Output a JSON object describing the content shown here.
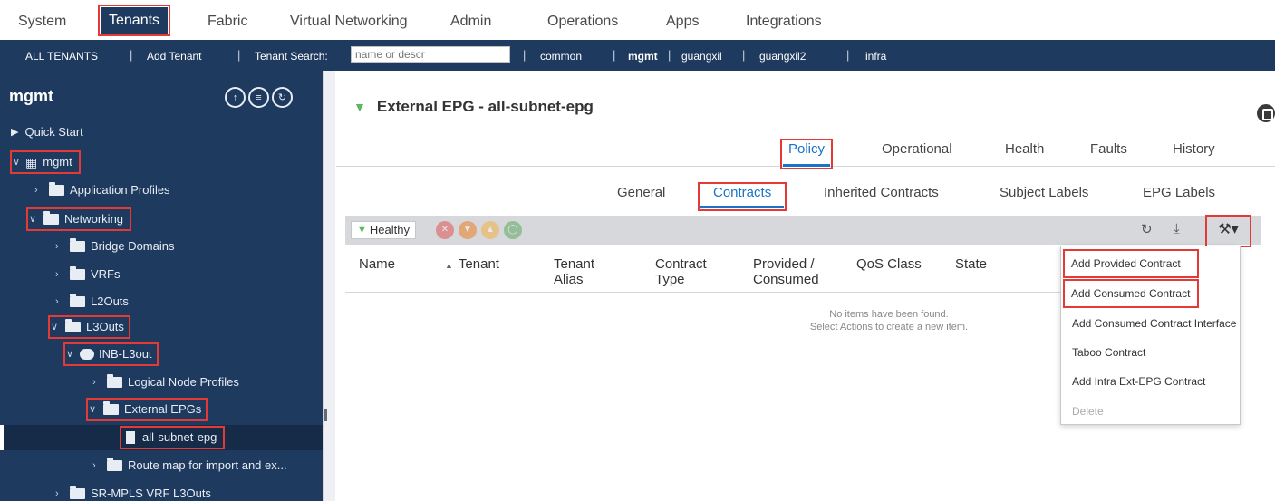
{
  "topmenu": {
    "items": [
      "System",
      "Tenants",
      "Fabric",
      "Virtual Networking",
      "Admin",
      "Operations",
      "Apps",
      "Integrations"
    ]
  },
  "tenantbar": {
    "all_tenants": "ALL TENANTS",
    "add_tenant": "Add Tenant",
    "search_label": "Tenant Search:",
    "search_placeholder": "name or descr",
    "tenants": [
      "common",
      "mgmt",
      "guangxil",
      "guangxil2",
      "infra"
    ],
    "active_tenant": "mgmt"
  },
  "sidebar": {
    "title": "mgmt",
    "tree": [
      {
        "label": "Quick Start",
        "icon": "quick-start-icon"
      },
      {
        "label": "mgmt",
        "icon": "tenant-icon"
      },
      {
        "label": "Application Profiles",
        "icon": "folder-icon"
      },
      {
        "label": "Networking",
        "icon": "folder-icon"
      },
      {
        "label": "Bridge Domains",
        "icon": "folder-icon"
      },
      {
        "label": "VRFs",
        "icon": "folder-icon"
      },
      {
        "label": "L2Outs",
        "icon": "folder-icon"
      },
      {
        "label": "L3Outs",
        "icon": "folder-icon"
      },
      {
        "label": "INB-L3out",
        "icon": "cloud-icon"
      },
      {
        "label": "Logical Node Profiles",
        "icon": "folder-icon"
      },
      {
        "label": "External EPGs",
        "icon": "folder-icon"
      },
      {
        "label": "all-subnet-epg",
        "icon": "epg-icon"
      },
      {
        "label": "Route map for import and ex...",
        "icon": "folder-icon"
      },
      {
        "label": "SR-MPLS VRF L3Outs",
        "icon": "folder-icon"
      }
    ]
  },
  "main": {
    "title": "External EPG - all-subnet-epg",
    "tabs1": [
      "Policy",
      "Operational",
      "Health",
      "Faults",
      "History"
    ],
    "tabs2": [
      "General",
      "Contracts",
      "Inherited Contracts",
      "Subject Labels",
      "EPG Labels"
    ],
    "health_label": "Healthy",
    "columns": [
      "Name",
      "Tenant",
      "Tenant\nAlias",
      "Contract\nType",
      "Provided /\nConsumed",
      "QoS Class",
      "State"
    ],
    "empty_line1": "No items have been found.",
    "empty_line2": "Select Actions to create a new item."
  },
  "actions_menu": {
    "items": [
      "Add Provided Contract",
      "Add Consumed Contract",
      "Add Consumed Contract Interface",
      "Taboo Contract",
      "Add Intra Ext-EPG Contract",
      "Delete"
    ]
  },
  "colors": {
    "nav_bg": "#1e3a5f",
    "accent": "#1a73c8",
    "highlight_box": "#e53935",
    "healthy": "#5cb85c"
  }
}
